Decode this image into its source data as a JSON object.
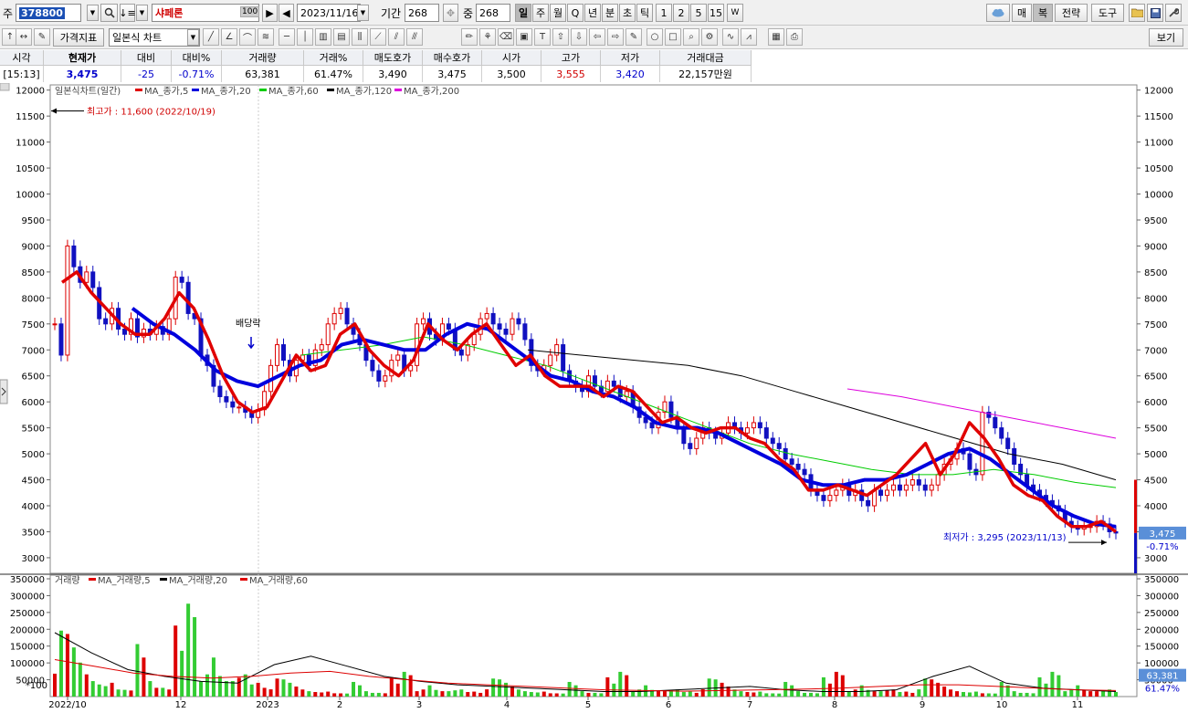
{
  "toolbar": {
    "market_label": "주",
    "code": "378800",
    "stock_name": "샤페론",
    "name_badge": "100",
    "date": "2023/11/16",
    "period_label": "기간",
    "period_value": "268",
    "count_label": "중",
    "count_value": "268",
    "period_buttons": [
      "일",
      "주",
      "월",
      "Q",
      "년",
      "분",
      "초",
      "틱",
      "1",
      "2",
      "5",
      "15"
    ],
    "right_buttons": [
      "매",
      "복",
      "전략",
      "도구"
    ],
    "price_index_label": "가격지표",
    "chart_type": "일본식 차트",
    "view_button": "보기"
  },
  "quote": {
    "headers": [
      "시각",
      "현재가",
      "대비",
      "대비%",
      "거래량",
      "거래%",
      "매도호가",
      "매수호가",
      "시가",
      "고가",
      "저가",
      "거래대금"
    ],
    "values": [
      "[15:13]",
      "3,475",
      "-25",
      "-0.71%",
      "63,381",
      "61.47%",
      "3,490",
      "3,475",
      "3,500",
      "3,555",
      "3,420",
      "22,157만원"
    ]
  },
  "colors": {
    "up": "#dd0000",
    "down": "#1010c0",
    "ma5": "#e00000",
    "ma20": "#0000dd",
    "ma60": "#00cc00",
    "ma120": "#000000",
    "ma200": "#dd00dd"
  },
  "chart_data": {
    "type": "line",
    "price_panel": {
      "title": "일본식차트(일간)",
      "legend": [
        "MA_종가,5",
        "MA_종가,20",
        "MA_종가,60",
        "MA_종가,120",
        "MA_종가,200"
      ],
      "ylim": [
        2700,
        12100
      ],
      "yticks": [
        3000,
        3500,
        4000,
        4500,
        5000,
        5500,
        6000,
        6500,
        7000,
        7500,
        8000,
        8500,
        9000,
        9500,
        10000,
        10500,
        11000,
        11500,
        12000
      ],
      "annotations": {
        "high": "최고가 : 11,600 (2022/10/19)",
        "low": "최저가 : 3,295 (2023/11/13)",
        "dividend": "배당락",
        "current_price": "3,475",
        "current_change": "-0.71%"
      },
      "candles_close": [
        7500,
        6900,
        9000,
        8600,
        8300,
        8500,
        8200,
        7600,
        7500,
        7800,
        7400,
        7300,
        7600,
        7250,
        7400,
        7300,
        7450,
        7300,
        7600,
        8400,
        8300,
        7700,
        7600,
        6900,
        6700,
        6300,
        6100,
        6000,
        5900,
        5900,
        5800,
        5700,
        5850,
        6200,
        6700,
        7100,
        6800,
        6500,
        6800,
        6900,
        6700,
        7000,
        7100,
        7500,
        7700,
        7800,
        7500,
        7300,
        7100,
        6800,
        6600,
        6400,
        6500,
        6800,
        6900,
        6600,
        6700,
        7500,
        7600,
        7300,
        7200,
        7500,
        7400,
        7000,
        6900,
        7100,
        7300,
        7600,
        7700,
        7500,
        7400,
        7300,
        7600,
        7500,
        7200,
        6700,
        6600,
        6700,
        6900,
        7100,
        6600,
        6400,
        6300,
        6200,
        6500,
        6300,
        6200,
        6400,
        6300,
        6100,
        6200,
        5900,
        5700,
        5600,
        5500,
        5800,
        6000,
        5700,
        5500,
        5200,
        5100,
        5300,
        5500,
        5400,
        5300,
        5400,
        5600,
        5500,
        5400,
        5500,
        5600,
        5500,
        5300,
        5200,
        5100,
        4900,
        4800,
        4700,
        4600,
        4300,
        4200,
        4100,
        4200,
        4300,
        4400,
        4200,
        4300,
        4100,
        4000,
        4300,
        4200,
        4300,
        4400,
        4300,
        4400,
        4500,
        4400,
        4300,
        4400,
        4600,
        4800,
        4900,
        5100,
        5000,
        4700,
        4600,
        5800,
        5700,
        5500,
        5300,
        5100,
        4800,
        4600,
        4400,
        4300,
        4200,
        4100,
        4000,
        3900,
        3700,
        3600,
        3550,
        3600,
        3600,
        3700,
        3650,
        3500,
        3475
      ],
      "ma5": [
        8300,
        8500,
        8100,
        7800,
        7500,
        7300,
        7300,
        7600,
        8100,
        7800,
        7200,
        6500,
        6000,
        5800,
        5900,
        6400,
        6900,
        6600,
        6700,
        7300,
        7500,
        7000,
        6700,
        6500,
        6800,
        7500,
        7200,
        7000,
        7300,
        7500,
        7100,
        6700,
        6900,
        6500,
        6300,
        6300,
        6300,
        6100,
        6300,
        6200,
        5900,
        5600,
        5700,
        5500,
        5400,
        5500,
        5500,
        5300,
        5200,
        4900,
        4700,
        4300,
        4300,
        4400,
        4300,
        4200,
        4400,
        4600,
        4900,
        5200,
        4600,
        5000,
        5600,
        5300,
        4900,
        4400,
        4200,
        4100,
        3800,
        3600,
        3600,
        3700,
        3500
      ],
      "ma20": [
        7800,
        7500,
        7300,
        7000,
        6600,
        6400,
        6300,
        6500,
        6700,
        6800,
        7100,
        7200,
        7100,
        7000,
        7000,
        7300,
        7500,
        7400,
        7100,
        6800,
        6500,
        6400,
        6200,
        6100,
        5900,
        5600,
        5500,
        5500,
        5400,
        5200,
        5000,
        4800,
        4500,
        4400,
        4400,
        4500,
        4500,
        4600,
        4800,
        5000,
        5100,
        4900,
        4600,
        4300,
        4000,
        3800,
        3650,
        3600
      ],
      "ma60": [
        6900,
        7000,
        7100,
        7250,
        7100,
        6900,
        6700,
        6400,
        6100,
        5800,
        5500,
        5200,
        5000,
        4850,
        4700,
        4600,
        4600,
        4700,
        4600,
        4450,
        4350
      ],
      "ma120": [
        7000,
        6900,
        6800,
        6700,
        6500,
        6200,
        5900,
        5600,
        5300,
        5000,
        4800,
        4500
      ],
      "ma200": [
        6250,
        6100,
        5900,
        5700,
        5500,
        5300
      ]
    },
    "volume_panel": {
      "title": "거래량",
      "legend": [
        "MA_거래량,5",
        "MA_거래량,20",
        "MA_거래량,60"
      ],
      "ylim": [
        0,
        350000
      ],
      "yticks": [
        50000,
        100000,
        150000,
        200000,
        250000,
        300000,
        350000
      ],
      "multiplier_label": "*100",
      "current_volume": "63,381",
      "current_ratio": "61.47%"
    },
    "x_labels": [
      "2022/10",
      "12",
      "2023",
      "2",
      "3",
      "4",
      "5",
      "6",
      "7",
      "8",
      "9",
      "10",
      "11"
    ]
  }
}
